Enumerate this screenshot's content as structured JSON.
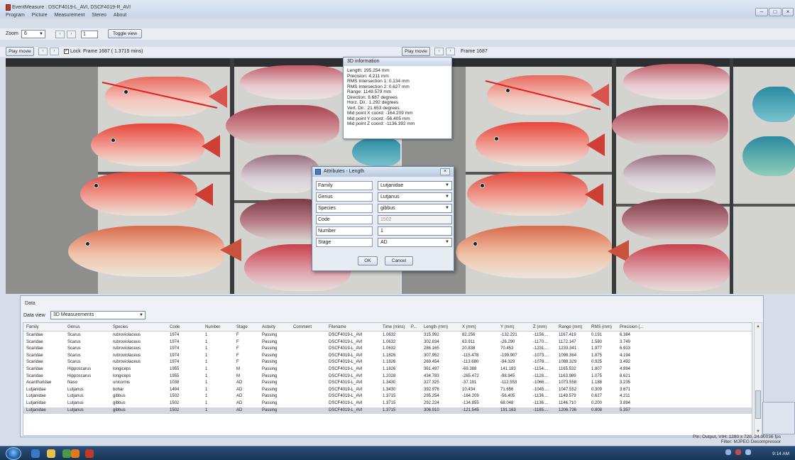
{
  "window": {
    "title": "EventMeasure : DSCF4019-L_AVI, DSCF4019-R_AVI",
    "controls": {
      "minimize": "–",
      "maximize": "□",
      "close": "×"
    }
  },
  "menu": [
    "Program",
    "Picture",
    "Measurement",
    "Stereo",
    "About"
  ],
  "toolbar": {
    "zoom_label": "Zoom",
    "zoom_value": "6",
    "frame_step_value": "1",
    "toggle_view": "Toggle view"
  },
  "left_view": {
    "play_movie": "Play movie",
    "lock_label": "Lock",
    "lock_checked": true,
    "frame_info": "Frame 1687 ( 1.3715 mins)"
  },
  "right_view": {
    "play_movie": "Play movie",
    "frame_info": "Frame 1687"
  },
  "info_panel": {
    "title": "3D information",
    "lines": [
      "Length: 295.254 mm",
      "Precision: 4.211 mm",
      "RMS Intersection 1: 0.134 mm",
      "RMS Intersection 2: 0.627 mm",
      "Range: 1149.579 mm",
      "Direction: 8.687 degrees",
      "Horz. Dir.: 1.292 degrees",
      "Vert. Dir.: 21.653 degrees",
      "Mid point X coord: -164.209 mm",
      "Mid point Y coord: -56.405 mm",
      "Mid point Z coord: -1136.392 mm"
    ]
  },
  "dialog": {
    "title": "Attributes - Length",
    "close": "×",
    "rows": [
      {
        "label": "Family",
        "value": "Lutjanidae",
        "dropdown": true
      },
      {
        "label": "Genus",
        "value": "Lutjanus",
        "dropdown": true
      },
      {
        "label": "Species",
        "value": "gibbus",
        "dropdown": true
      },
      {
        "label": "Code",
        "value": "1502",
        "disabled": true
      },
      {
        "label": "Number",
        "value": "1"
      },
      {
        "label": "Stage",
        "value": "AD",
        "dropdown": true
      }
    ],
    "ok": "OK",
    "cancel": "Cancel"
  },
  "data_panel": {
    "title": "Data",
    "view_label": "Data view",
    "view_value": "3D Measurements",
    "columns": [
      "Family",
      "Genus",
      "Species",
      "Code",
      "Number",
      "Stage",
      "Activity",
      "Comment",
      "Filename",
      "Time (mins)",
      "P...",
      "Length (mm)",
      "X (mm)",
      "Y (mm)",
      "Z (mm)",
      "Range (mm)",
      "RMS (mm)",
      "Precision (..."
    ],
    "rows": [
      [
        "Scaridae",
        "Scarus",
        "rubroviolaceus",
        "1974",
        "1",
        "F",
        "Passing",
        "",
        "DSCF4019-L_AVI",
        "1.0632",
        "",
        "315.992",
        "82.256",
        "-132.221",
        "-1156....",
        "1167.419",
        "0.191",
        "6.384"
      ],
      [
        "Scaridae",
        "Scarus",
        "rubroviolaceus",
        "1974",
        "1",
        "F",
        "Passing",
        "",
        "DSCF4019-L_AVI",
        "1.0632",
        "",
        "302.834",
        "63.911",
        "-26.290",
        "-1170....",
        "1172.147",
        "1.580",
        "3.749"
      ],
      [
        "Scaridae",
        "Scarus",
        "rubroviolaceus",
        "1974",
        "1",
        "F",
        "Passing",
        "",
        "DSCF4019-L_AVI",
        "1.0632",
        "",
        "286.165",
        "20.838",
        "70.453",
        "-1231....",
        "1233.341",
        "1.977",
        "6.913"
      ],
      [
        "Scaridae",
        "Scarus",
        "rubroviolaceus",
        "1974",
        "1",
        "F",
        "Passing",
        "",
        "DSCF4019-L_AVI",
        "1.1826",
        "",
        "307.952",
        "-115.478",
        "-199.907",
        "-1073....",
        "1098.364",
        "1.875",
        "4.194"
      ],
      [
        "Scaridae",
        "Scarus",
        "rubroviolaceus",
        "1974",
        "1",
        "F",
        "Passing",
        "",
        "DSCF4019-L_AVI",
        "1.1826",
        "",
        "269.454",
        "-113.680",
        "-94.329",
        "-1078....",
        "1088.329",
        "0.925",
        "3.492"
      ],
      [
        "Scaridae",
        "Hipposcarus",
        "longiceps",
        "1955",
        "1",
        "M",
        "Passing",
        "",
        "DSCF4019-L_AVI",
        "1.1826",
        "",
        "361.497",
        "-69.388",
        "141.183",
        "-1154....",
        "1165.532",
        "1.807",
        "4.894"
      ],
      [
        "Scaridae",
        "Hipposcarus",
        "longiceps",
        "1955",
        "1",
        "M",
        "Passing",
        "",
        "DSCF4019-L_AVI",
        "1.2028",
        "",
        "434.783",
        "-265.472",
        "-98.945",
        "-1128....",
        "1163.989",
        "1.075",
        "8.621"
      ],
      [
        "Acanthuridae",
        "Naso",
        "unicornis",
        "1038",
        "1",
        "AD",
        "Passing",
        "",
        "DSCF4019-L_AVI",
        "1.3430",
        "",
        "327.325",
        "-37.191",
        "-112.553",
        "-1066....",
        "1073.558",
        "1.188",
        "3.235"
      ],
      [
        "Lutjanidae",
        "Lutjanus",
        "bohar",
        "1494",
        "1",
        "AD",
        "Passing",
        "",
        "DSCF4019-L_AVI",
        "1.3430",
        "",
        "392.976",
        "10.434",
        "71.656",
        "-1045....",
        "1047.552",
        "0.309",
        "3.671"
      ],
      [
        "Lutjanidae",
        "Lutjanus",
        "gibbus",
        "1502",
        "1",
        "AD",
        "Passing",
        "",
        "DSCF4019-L_AVI",
        "1.3715",
        "",
        "295.254",
        "-164.209",
        "-56.405",
        "-1136....",
        "1149.579",
        "0.627",
        "4.211"
      ],
      [
        "Lutjanidae",
        "Lutjanus",
        "gibbus",
        "1502",
        "1",
        "AD",
        "Passing",
        "",
        "DSCF4019-L_AVI",
        "1.3715",
        "",
        "292.224",
        "-134.855",
        "68.048",
        "-1136....",
        "1146.710",
        "0.200",
        "3.894"
      ],
      [
        "Lutjanidae",
        "Lutjanus",
        "gibbus",
        "1502",
        "1",
        "AD",
        "Passing",
        "",
        "DSCF4019-L_AVI",
        "1.3715",
        "",
        "306.910",
        "-121.545",
        "191.163",
        "-1185....",
        "1206.736",
        "0.808",
        "5.357"
      ]
    ],
    "selected_row": 11
  },
  "status": {
    "line1": "Pin: Output, VIH: 1280 x 720, 24.00036 fps",
    "line2": "Filter: MJPEG Decompressor"
  },
  "taskbar": {
    "time": "9:14 AM"
  },
  "colors": {
    "measure_line": "#e02020",
    "snapper_red": "#d9534f",
    "parrotfish_teal": "#2b8aa0",
    "selected_row": "#d3d8e0",
    "taskbar": "#1f3d62"
  }
}
